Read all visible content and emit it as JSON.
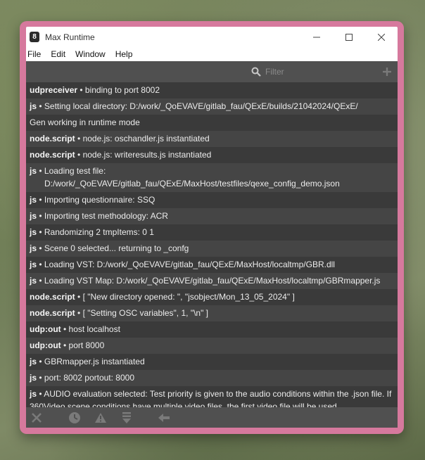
{
  "window": {
    "title": "Max Runtime",
    "icon": "max-app-icon"
  },
  "menu": {
    "items": [
      "File",
      "Edit",
      "Window",
      "Help"
    ]
  },
  "toolbar": {
    "filter_placeholder": "Filter",
    "filter_value": ""
  },
  "console": {
    "rows": [
      {
        "source": "udpreceiver",
        "message": "binding to port 8002"
      },
      {
        "source": "js",
        "message": "Setting local directory:   D:/work/_QoEVAVE/gitlab_fau/QExE/builds/21042024/QExE/"
      },
      {
        "source": "",
        "message": "Gen working in runtime mode"
      },
      {
        "source": "node.script",
        "message": "node.js: oschandler.js instantiated"
      },
      {
        "source": "node.script",
        "message": "node.js: writeresults.js instantiated"
      },
      {
        "source": "js",
        "message": "Loading test file:",
        "message2": "D:/work/_QoEVAVE/gitlab_fau/QExE/MaxHost/testfiles/qexe_config_demo.json"
      },
      {
        "source": "js",
        "message": "Importing questionnaire:  SSQ"
      },
      {
        "source": "js",
        "message": "Importing test methodology:   ACR"
      },
      {
        "source": "js",
        "message": "Randomizing  2  tmpItems:  0  1"
      },
      {
        "source": "js",
        "message": "Scene 0 selected... returning to _confg"
      },
      {
        "source": "js",
        "message": "Loading VST:  D:/work/_QoEVAVE/gitlab_fau/QExE/MaxHost/localtmp/GBR.dll"
      },
      {
        "source": "js",
        "message": "Loading VST Map:  D:/work/_QoEVAVE/gitlab_fau/QExE/MaxHost/localtmp/GBRmapper.js"
      },
      {
        "source": "node.script",
        "message": "[ \"New directory opened: \", \"jsobject/Mon_13_05_2024\" ]"
      },
      {
        "source": "node.script",
        "message": "[ \"Setting OSC variables\", 1, \"\\n\" ]"
      },
      {
        "source": "udp:out",
        "message": "host localhost"
      },
      {
        "source": "udp:out",
        "message": "port 8000"
      },
      {
        "source": "js",
        "message": "GBRmapper.js instantiated"
      },
      {
        "source": "js",
        "message": "port:  8002  portout:  8000"
      },
      {
        "source": "js",
        "message": "AUDIO evaluation selected: Test priority is given to the audio conditions within the .json file. If 360Video scene conditions have multiple video files, the first video file will be used."
      },
      {
        "source": "",
        "message": ""
      },
      {
        "source": "",
        "message": ""
      }
    ]
  },
  "bottom_bar": {
    "icons": [
      "clear-icon",
      "clock-icon",
      "warning-icon",
      "scroll-down-icon",
      "back-arrow-icon"
    ]
  },
  "colors": {
    "frame": "#d6799d",
    "console_bg": "#3e3e3e",
    "toolbar_bg": "#505050",
    "text": "#ececec"
  }
}
